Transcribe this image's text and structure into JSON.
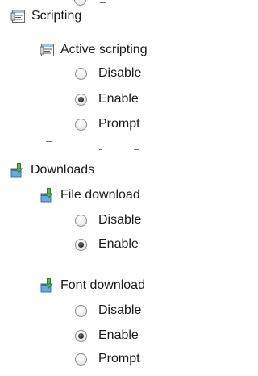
{
  "tree": {
    "scripting": {
      "label": "Scripting",
      "icon": "script-settings-icon",
      "active_scripting": {
        "label": "Active scripting",
        "icon": "script-settings-icon",
        "options": [
          {
            "label": "Disable",
            "selected": false
          },
          {
            "label": "Enable",
            "selected": true
          },
          {
            "label": "Prompt",
            "selected": false
          }
        ]
      }
    },
    "downloads": {
      "label": "Downloads",
      "icon": "download-settings-icon",
      "file_download": {
        "label": "File download",
        "icon": "download-settings-icon",
        "options": [
          {
            "label": "Disable",
            "selected": false
          },
          {
            "label": "Enable",
            "selected": true
          }
        ]
      },
      "font_download": {
        "label": "Font download",
        "icon": "download-settings-icon",
        "options": [
          {
            "label": "Disable",
            "selected": false
          },
          {
            "label": "Enable",
            "selected": true
          },
          {
            "label": "Prompt",
            "selected": false
          }
        ]
      }
    }
  }
}
